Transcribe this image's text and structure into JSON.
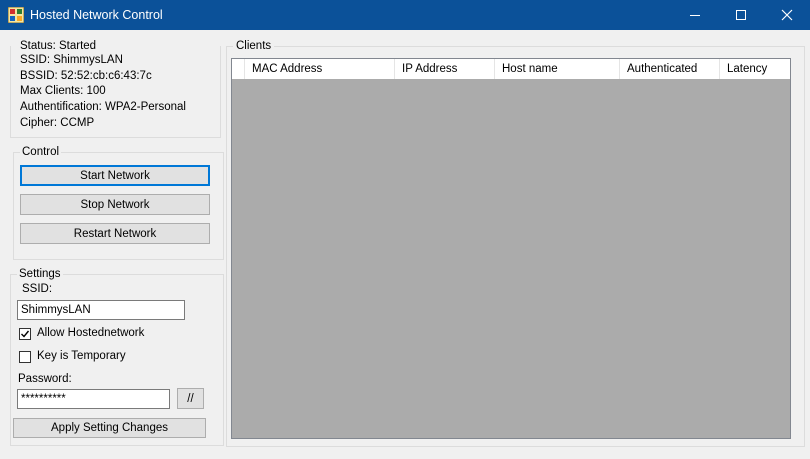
{
  "window": {
    "title": "Hosted Network Control"
  },
  "status": {
    "status_line": "Status: Started",
    "ssid_line": "SSID: ShimmysLAN",
    "bssid_line": "BSSID: 52:52:cb:c6:43:7c",
    "max_clients_line": "Max Clients: 100",
    "auth_line": "Authentification: WPA2-Personal",
    "cipher_line": "Cipher: CCMP"
  },
  "control": {
    "title": "Control",
    "start_label": "Start Network",
    "stop_label": "Stop Network",
    "restart_label": "Restart Network"
  },
  "settings": {
    "title": "Settings",
    "ssid_label": "SSID:",
    "ssid_value": "ShimmysLAN",
    "allow_label": "Allow Hostednetwork",
    "allow_checked": true,
    "temp_label": "Key is Temporary",
    "temp_checked": false,
    "password_label": "Password:",
    "password_value": "**********",
    "toggle_label": "//",
    "apply_label": "Apply Setting Changes"
  },
  "clients": {
    "title": "Clients",
    "columns": [
      "MAC Address",
      "IP Address",
      "Host name",
      "Authenticated",
      "Latency"
    ],
    "rows": []
  }
}
